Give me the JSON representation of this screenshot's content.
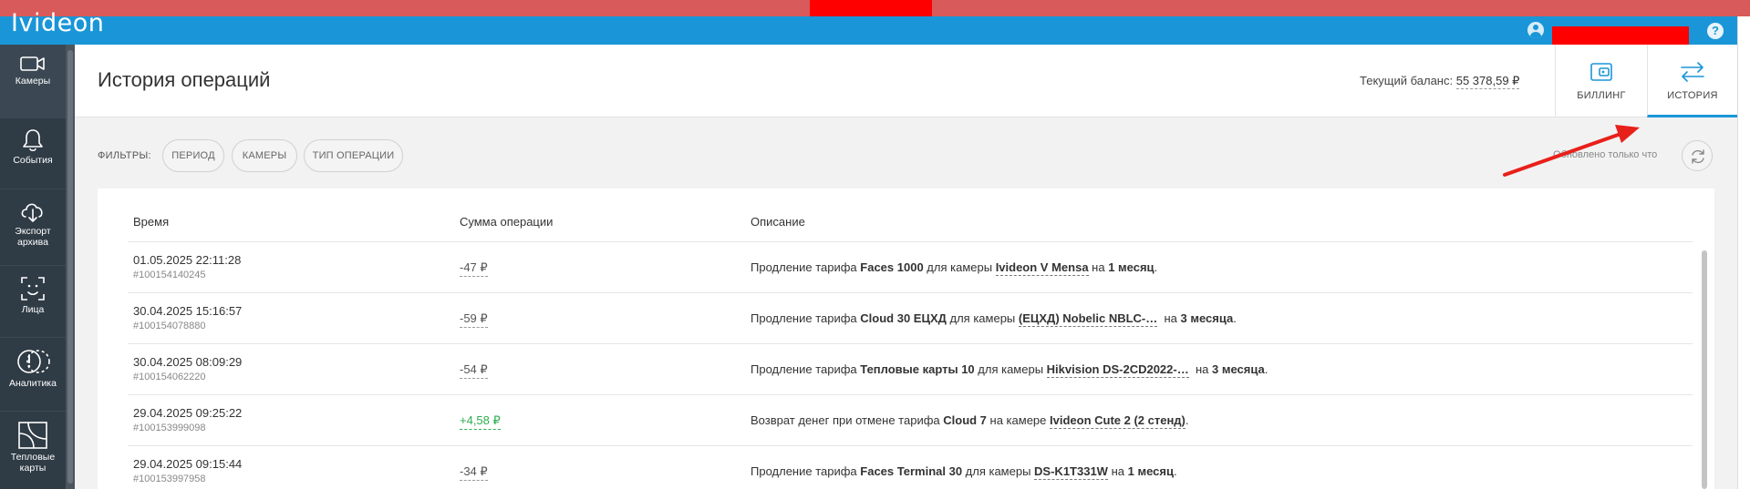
{
  "app": {
    "logo": "Ivideon"
  },
  "topbar": {
    "help_label": "?"
  },
  "sidebar": {
    "items": [
      {
        "label": "Камеры",
        "icon": "camera-icon"
      },
      {
        "label": "События",
        "icon": "bell-icon"
      },
      {
        "label": "Экспорт архива",
        "icon": "cloud-download-icon"
      },
      {
        "label": "Лица",
        "icon": "face-scan-icon"
      },
      {
        "label": "Аналитика",
        "icon": "analytics-icon"
      },
      {
        "label": "Тепловые карты",
        "icon": "heatmap-icon"
      }
    ]
  },
  "header": {
    "title": "История операций",
    "balance_label": "Текущий баланс:",
    "balance_value": "55 378,59 ₽",
    "tabs": [
      {
        "label": "БИЛЛИНГ",
        "icon": "wallet-icon",
        "active": false
      },
      {
        "label": "ИСТОРИЯ",
        "icon": "transfer-arrows-icon",
        "active": true
      }
    ]
  },
  "filters": {
    "label": "ФИЛЬТРЫ:",
    "chips": [
      "ПЕРИОД",
      "КАМЕРЫ",
      "ТИП ОПЕРАЦИИ"
    ],
    "updated_text": "Обновлено только что"
  },
  "table": {
    "columns": [
      "Время",
      "Сумма операции",
      "Описание"
    ],
    "rows": [
      {
        "time": "01.05.2025 22:11:28",
        "id": "#100154140245",
        "sum": "-47 ₽",
        "desc_pre": "Продление тарифа ",
        "tariff": "Faces 1000",
        "desc_mid": " для камеры ",
        "camera": "Ivideon V Mensa",
        "desc_post": " на ",
        "period": "1 месяц",
        "desc_end": "."
      },
      {
        "time": "30.04.2025 15:16:57",
        "id": "#100154078880",
        "sum": "-59 ₽",
        "desc_pre": "Продление тарифа ",
        "tariff": "Cloud 30 ЕЦХД",
        "desc_mid": " для камеры ",
        "camera": "(ЕЦХД) Nobelic NBLC-…",
        "desc_post": "  на ",
        "period": "3 месяца",
        "desc_end": "."
      },
      {
        "time": "30.04.2025 08:09:29",
        "id": "#100154062220",
        "sum": "-54 ₽",
        "desc_pre": "Продление тарифа ",
        "tariff": "Тепловые карты 10",
        "desc_mid": " для камеры ",
        "camera": "Hikvision DS-2CD2022-…",
        "desc_post": "  на ",
        "period": "3 месяца",
        "desc_end": "."
      },
      {
        "time": "29.04.2025 09:25:22",
        "id": "#100153999098",
        "sum": "+4,58 ₽",
        "desc_pre": "Возврат денег при отмене тарифа ",
        "tariff": "Cloud 7",
        "desc_mid": " на камере ",
        "camera": "Ivideon Cute 2 (2 стенд)",
        "desc_post": "",
        "period": "",
        "desc_end": "."
      },
      {
        "time": "29.04.2025 09:15:44",
        "id": "#100153997958",
        "sum": "-34 ₽",
        "desc_pre": "Продление тарифа ",
        "tariff": "Faces Terminal 30",
        "desc_mid": " для камеры ",
        "camera": "DS-K1T331W",
        "desc_post": " на ",
        "period": "1 месяц",
        "desc_end": "."
      }
    ]
  },
  "colors": {
    "topbar": "#1a96d8",
    "sidebar": "#2f3b45",
    "positive": "#2dae4f",
    "annotation_arrow": "#e8201a",
    "redaction": "#ff0000"
  }
}
